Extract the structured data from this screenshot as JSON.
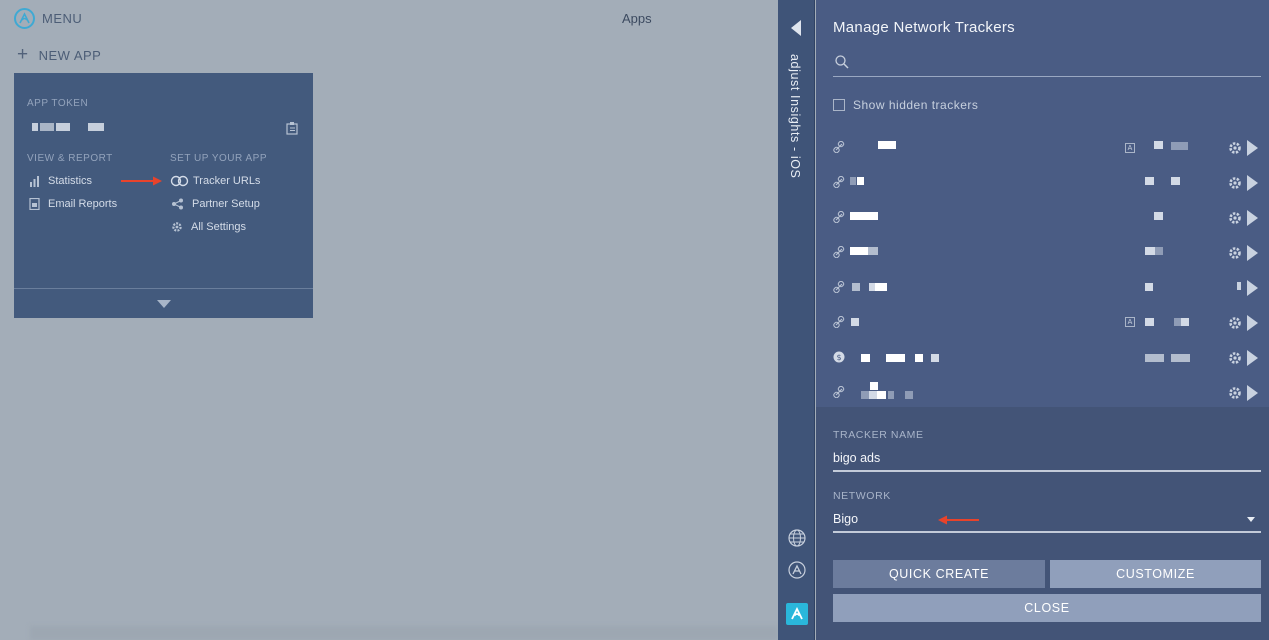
{
  "header": {
    "menu_label": "MENU",
    "page_title": "Apps",
    "new_app_label": "NEW APP"
  },
  "app_card": {
    "token_label": "APP TOKEN",
    "view_report_heading": "VIEW & REPORT",
    "setup_heading": "SET UP YOUR APP",
    "links": {
      "statistics": "Statistics",
      "email_reports": "Email Reports",
      "tracker_urls": "Tracker URLs",
      "partner_setup": "Partner Setup",
      "all_settings": "All Settings"
    }
  },
  "strip": {
    "app_name": "adjust Insights - iOS"
  },
  "panel": {
    "title": "Manage Network Trackers",
    "search_placeholder": "",
    "show_hidden_label": "Show hidden trackers",
    "tracker_name_label": "TRACKER NAME",
    "tracker_name_value": "bigo ads",
    "network_label": "NETWORK",
    "network_value": "Bigo",
    "quick_create_label": "QUICK CREATE",
    "customize_label": "CUSTOMIZE",
    "close_label": "CLOSE"
  },
  "colors": {
    "accent": "#2ab7db",
    "annotation_arrow": "#e8432b",
    "panel_bg": "#4a5c84",
    "card_bg": "#435a7d"
  },
  "icons": [
    "menu-logo-icon",
    "plus-icon",
    "clipboard-icon",
    "bar-chart-icon",
    "document-icon",
    "link-icon",
    "share-icon",
    "gear-icon",
    "chevron-down-icon",
    "search-icon",
    "globe-icon",
    "app-store-icon",
    "play-icon"
  ]
}
